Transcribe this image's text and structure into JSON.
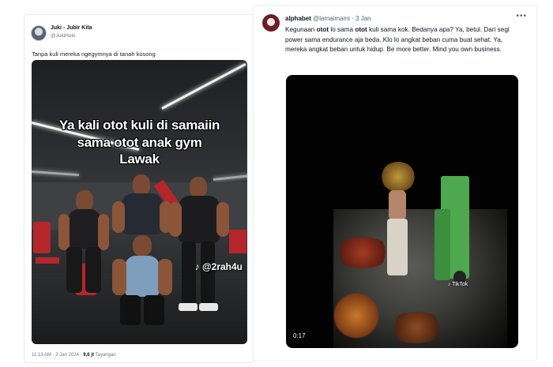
{
  "left_tweet": {
    "author_name": "Juki - Jubir Kita",
    "handle": "@JukiHoki",
    "text": "Tanpa kuli mereka ngegymnya di tanah kosong",
    "video_caption_lines": [
      "Ya kali otot kuli di samaiin",
      "sama otot anak gym",
      "Lawak"
    ],
    "watermark": "@2rah4u",
    "time": "11:13 AM · 3 Jan 2024 · ",
    "views_count": "9,6 jt",
    "views_label": " Tayangan"
  },
  "right_tweet": {
    "author_name": "alphabet",
    "handle": "@lamaimami",
    "date": "· 3 Jan",
    "more_icon": "•••",
    "text": [
      {
        "t": "Kegunaan ",
        "b": false
      },
      {
        "t": "otot",
        "b": true
      },
      {
        "t": " lo sama ",
        "b": false
      },
      {
        "t": "otot",
        "b": true
      },
      {
        "t": " kuli sama kok. Bedanya apa? Ya, betul. Dari segi power sama endurance aja beda. Klo lo angkat beban cuma buat sehat. Ya, mereka angkat beban untuk hidup. Be more better. Mind you own business.",
        "b": false
      }
    ],
    "video_time": "0:17",
    "video_watermark": "TikTok"
  },
  "colors": {
    "text_primary": "#0f1419",
    "text_secondary": "#536471",
    "border": "#e6e9eb",
    "truck_green": "#4ea84d"
  }
}
